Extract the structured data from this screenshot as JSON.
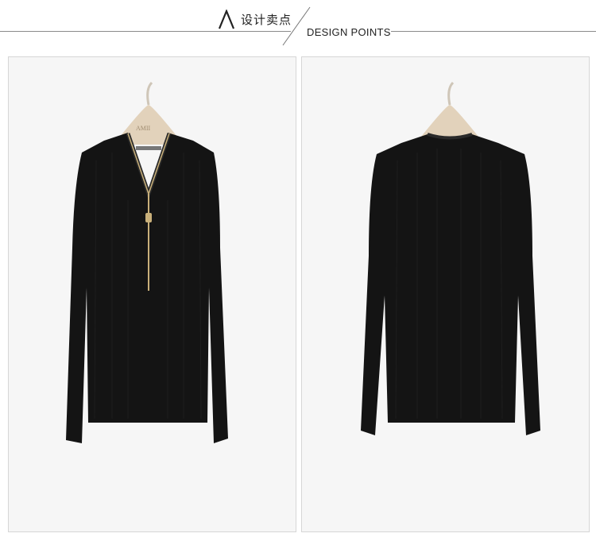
{
  "header": {
    "logo_icon": "caret-up-logo-icon",
    "title_cn": "设计卖点",
    "title_en": "DESIGN POINTS",
    "line_color": "#8a8a8a"
  },
  "product": {
    "front_view": {
      "hanger_icon": "wooden-hanger-icon",
      "garment": "black ribbed v-neck sweater with gold zipper",
      "hanger_brand_text": "AMII"
    },
    "back_view": {
      "hanger_icon": "wooden-hanger-icon",
      "garment": "black ribbed sweater back view"
    },
    "colors": {
      "garment": "#141414",
      "zipper": "#c9b07a",
      "hanger": "#e2d2bb",
      "panel_bg": "#f6f6f6"
    }
  }
}
